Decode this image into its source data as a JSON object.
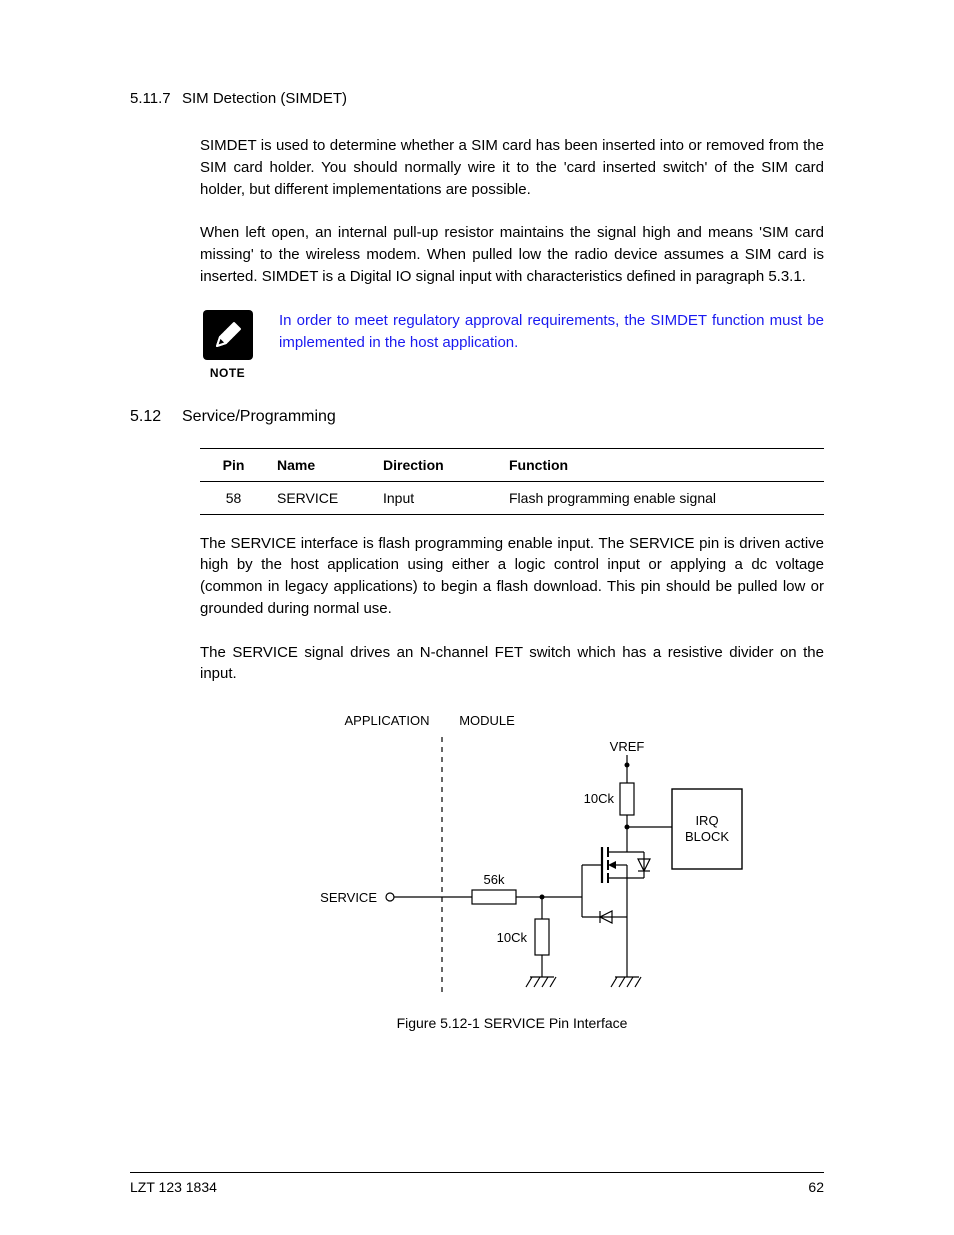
{
  "sections": {
    "sim": {
      "number": "5.11.7",
      "title": "SIM Detection (SIMDET)",
      "para1": "SIMDET is used to determine whether a SIM card has been inserted into or removed from the SIM card holder. You should normally wire it to the 'card inserted switch' of the SIM card holder, but different implementations are possible.",
      "para2": "When left open, an internal pull-up resistor maintains the signal high and means 'SIM card missing' to the wireless modem. When pulled low the radio device assumes a SIM card is inserted. SIMDET is a Digital IO signal input with characteristics defined in paragraph 5.3.1."
    },
    "note": {
      "label": "NOTE",
      "text": "In order to meet regulatory approval requirements, the SIMDET function must be implemented in the host application."
    },
    "svc": {
      "number": "5.12",
      "title": "Service/Programming",
      "para1": "The SERVICE interface is flash programming enable input.  The SERVICE pin is driven active high by the host application using either a logic control input or applying a dc voltage (common in legacy applications) to begin a flash download.  This pin should be pulled low or grounded during normal use.",
      "para2": "The SERVICE signal drives an N-channel FET switch which has a resistive divider on the input."
    }
  },
  "table": {
    "headers": {
      "pin": "Pin",
      "name": "Name",
      "direction": "Direction",
      "function": "Function"
    },
    "row": {
      "pin": "58",
      "name": "SERVICE",
      "direction": "Input",
      "function": "Flash programming enable signal"
    }
  },
  "figure": {
    "caption": "Figure 5.12-1  SERVICE Pin Interface",
    "labels": {
      "application": "APPLICATION",
      "module": "MODULE",
      "vref": "VREF",
      "irq": "IRQ",
      "block": "BLOCK",
      "service": "SERVICE",
      "r56k": "56k",
      "r10k_top": "10Ck",
      "r10k_bot": "10Ck"
    }
  },
  "footer": {
    "left": "LZT 123 1834",
    "right": "62"
  }
}
